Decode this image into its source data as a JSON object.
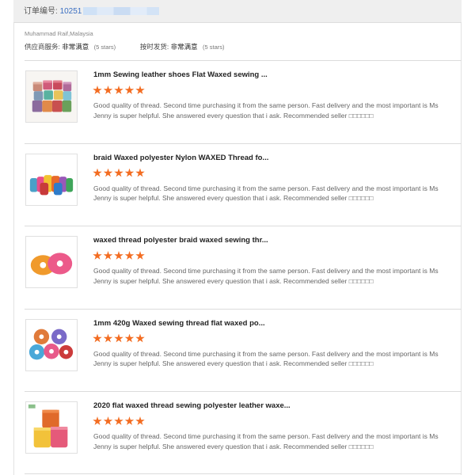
{
  "order": {
    "label": "订单编号:",
    "number": "10251"
  },
  "buyer": {
    "name": "Muhammad Raif,Malaysia"
  },
  "ratings": {
    "supplier_label": "供应商服务:",
    "supplier_value": "非常满意",
    "supplier_stars": "(5 stars)",
    "shipping_label": "按时发货:",
    "shipping_value": "非常满意",
    "shipping_stars": "(5 stars)"
  },
  "reviews": [
    {
      "title": "1mm Sewing leather shoes Flat Waxed sewing ...",
      "rating": 5,
      "text": "Good quality of thread. Second time purchasing it from the same person. Fast delivery and the most important is Ms Jenny is super helpful. She answered every question that i ask. Recommended seller □□□□□□",
      "thumb_icon": "thread-spools-grid-image"
    },
    {
      "title": "braid Waxed polyester Nylon WAXED Thread fo...",
      "rating": 5,
      "text": "Good quality of thread. Second time purchasing it from the same person. Fast delivery and the most important is Ms Jenny is super helpful. She answered every question that i ask. Recommended seller □□□□□□",
      "thumb_icon": "thread-cones-row-image"
    },
    {
      "title": "waxed thread polyester braid waxed sewing thr...",
      "rating": 5,
      "text": "Good quality of thread. Second time purchasing it from the same person. Fast delivery and the most important is Ms Jenny is super helpful. She answered every question that i ask. Recommended seller □□□□□□",
      "thumb_icon": "thread-spools-pair-image"
    },
    {
      "title": "1mm 420g Waxed sewing thread flat waxed po...",
      "rating": 5,
      "text": "Good quality of thread. Second time purchasing it from the same person. Fast delivery and the most important is Ms Jenny is super helpful. She answered every question that i ask. Recommended seller □□□□□□",
      "thumb_icon": "thread-spools-cluster-image"
    },
    {
      "title": "2020 flat waxed thread sewing polyester leather waxe...",
      "rating": 5,
      "text": "Good quality of thread. Second time purchasing it from the same person. Fast delivery and the most important is Ms Jenny is super helpful. She answered every question that i ask. Recommended seller □□□□□□",
      "thumb_icon": "thread-cones-stack-image"
    }
  ],
  "colors": {
    "star": "#f36c21",
    "order_number": "#3b6fc2",
    "header_bg": "#efefef"
  }
}
